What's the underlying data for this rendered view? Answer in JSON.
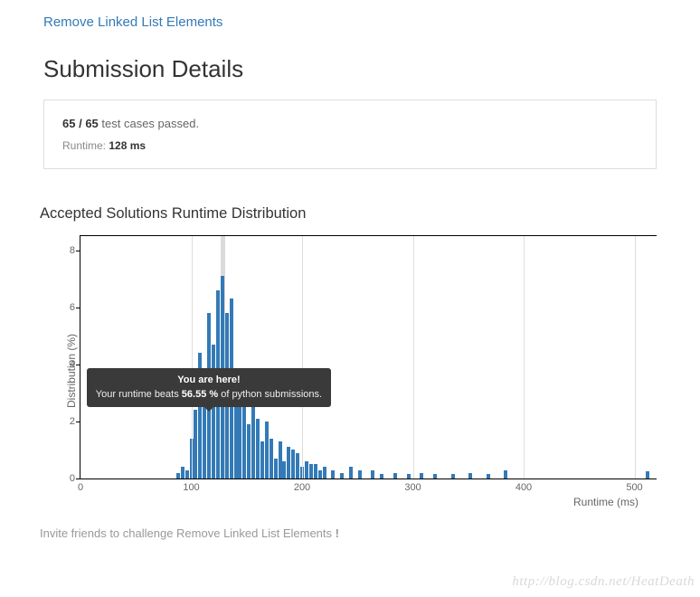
{
  "problem_link": "Remove Linked List Elements",
  "page_title": "Submission Details",
  "stats": {
    "passed": "65",
    "total": "65",
    "test_cases_suffix": " test cases passed.",
    "runtime_prefix": "Runtime: ",
    "runtime_value": "128 ms"
  },
  "chart_title": "Accepted Solutions Runtime Distribution",
  "chart_data": {
    "type": "bar",
    "xlabel": "Runtime (ms)",
    "ylabel": "Distribution (%)",
    "xlim": [
      0,
      520
    ],
    "ylim": [
      0,
      8.5
    ],
    "xticks": [
      0,
      100,
      200,
      300,
      400,
      500
    ],
    "yticks": [
      0,
      2,
      4,
      6,
      8
    ],
    "you_are_here_x": 128,
    "values": [
      {
        "x": 88,
        "y": 0.2
      },
      {
        "x": 92,
        "y": 0.4
      },
      {
        "x": 96,
        "y": 0.3
      },
      {
        "x": 100,
        "y": 1.4
      },
      {
        "x": 104,
        "y": 2.4
      },
      {
        "x": 108,
        "y": 4.4
      },
      {
        "x": 112,
        "y": 3.3
      },
      {
        "x": 116,
        "y": 5.8
      },
      {
        "x": 120,
        "y": 4.7
      },
      {
        "x": 124,
        "y": 6.6
      },
      {
        "x": 128,
        "y": 7.1
      },
      {
        "x": 132,
        "y": 5.8
      },
      {
        "x": 136,
        "y": 6.3
      },
      {
        "x": 140,
        "y": 3.2
      },
      {
        "x": 144,
        "y": 3.2
      },
      {
        "x": 148,
        "y": 3.1
      },
      {
        "x": 152,
        "y": 1.9
      },
      {
        "x": 156,
        "y": 2.5
      },
      {
        "x": 160,
        "y": 2.1
      },
      {
        "x": 164,
        "y": 1.3
      },
      {
        "x": 168,
        "y": 2.0
      },
      {
        "x": 172,
        "y": 1.4
      },
      {
        "x": 176,
        "y": 0.7
      },
      {
        "x": 180,
        "y": 1.3
      },
      {
        "x": 184,
        "y": 0.6
      },
      {
        "x": 188,
        "y": 1.1
      },
      {
        "x": 192,
        "y": 1.0
      },
      {
        "x": 196,
        "y": 0.9
      },
      {
        "x": 200,
        "y": 0.4
      },
      {
        "x": 204,
        "y": 0.6
      },
      {
        "x": 208,
        "y": 0.5
      },
      {
        "x": 212,
        "y": 0.5
      },
      {
        "x": 216,
        "y": 0.3
      },
      {
        "x": 220,
        "y": 0.4
      },
      {
        "x": 228,
        "y": 0.3
      },
      {
        "x": 236,
        "y": 0.2
      },
      {
        "x": 244,
        "y": 0.4
      },
      {
        "x": 252,
        "y": 0.3
      },
      {
        "x": 264,
        "y": 0.3
      },
      {
        "x": 272,
        "y": 0.15
      },
      {
        "x": 284,
        "y": 0.2
      },
      {
        "x": 296,
        "y": 0.15
      },
      {
        "x": 308,
        "y": 0.2
      },
      {
        "x": 320,
        "y": 0.15
      },
      {
        "x": 336,
        "y": 0.15
      },
      {
        "x": 352,
        "y": 0.2
      },
      {
        "x": 368,
        "y": 0.15
      },
      {
        "x": 384,
        "y": 0.3
      },
      {
        "x": 512,
        "y": 0.25
      }
    ]
  },
  "tooltip": {
    "line1": "You are here!",
    "line2_prefix": "Your runtime beats ",
    "percent": "56.55 %",
    "line2_suffix": " of python submissions."
  },
  "invite": {
    "prefix": "Invite friends to challenge ",
    "problem": "Remove Linked List Elements",
    "suffix": " !"
  },
  "watermark": "http://blog.csdn.net/HeatDeath"
}
